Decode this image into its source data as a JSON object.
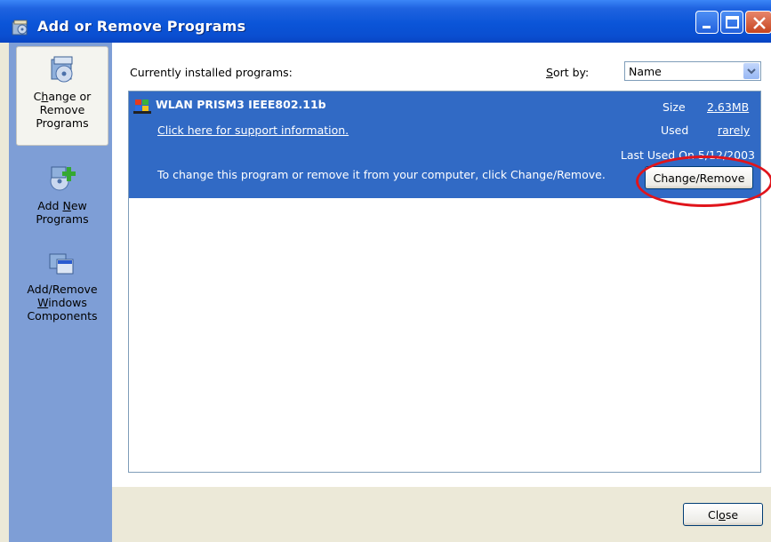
{
  "window": {
    "title": "Add or Remove Programs",
    "colors": {
      "titlebar": "#0a4ed0",
      "sidebar": "#7e9ed6",
      "selection": "#316ac5",
      "highlight_oval": "#e0141b"
    }
  },
  "sidebar": {
    "items": [
      {
        "label_pre": "C",
        "label_acc": "h",
        "label_post": "ange or Remove Programs",
        "icon": "change-remove-programs-icon",
        "active": true
      },
      {
        "label_pre": "Add ",
        "label_acc": "N",
        "label_post": "ew Programs",
        "icon": "add-new-programs-icon",
        "active": false
      },
      {
        "label_pre": "Add/Remove ",
        "label_acc": "W",
        "label_post": "indows Components",
        "icon": "add-remove-windows-components-icon",
        "active": false
      }
    ]
  },
  "main": {
    "installed_label": "Currently installed programs:",
    "sort_label_acc": "S",
    "sort_label_rest": "ort by:",
    "sort_value": "Name",
    "program": {
      "name": "WLAN PRISM3 IEEE802.11b",
      "support_link": "Click here for support information.",
      "size_label": "Size",
      "size_value": "2.63MB",
      "used_label": "Used",
      "used_value": "rarely",
      "last_used": "Last Used On 5/12/2003",
      "change_text": "To change this program or remove it from your computer, click Change/Remove.",
      "change_button": "Change/Remove"
    }
  },
  "footer": {
    "close_pre": "Cl",
    "close_acc": "o",
    "close_post": "se"
  }
}
